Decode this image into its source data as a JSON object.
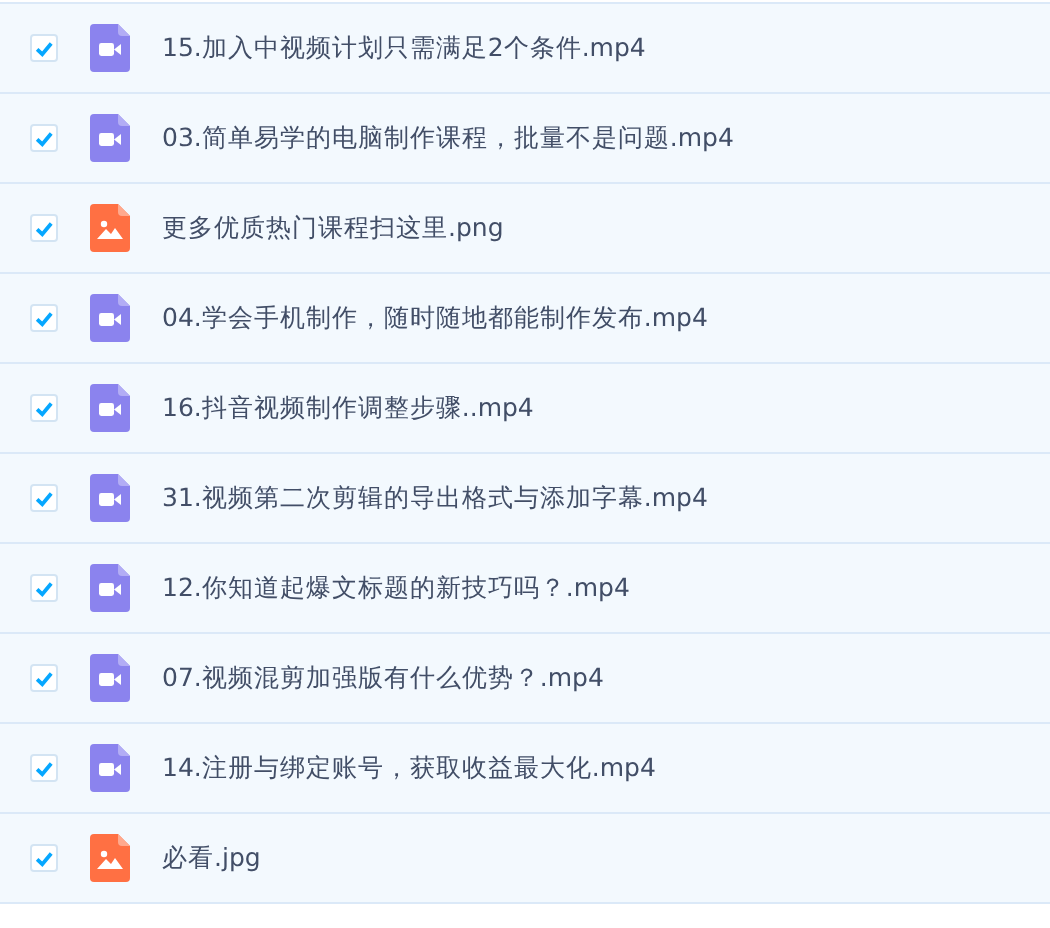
{
  "files": [
    {
      "name": "15.加入中视频计划只需满足2个条件.mp4",
      "kind": "video",
      "checked": true
    },
    {
      "name": "03.简单易学的电脑制作课程，批量不是问题.mp4",
      "kind": "video",
      "checked": true
    },
    {
      "name": "更多优质热门课程扫这里.png",
      "kind": "image",
      "checked": true
    },
    {
      "name": "04.学会手机制作，随时随地都能制作发布.mp4",
      "kind": "video",
      "checked": true
    },
    {
      "name": "16.抖音视频制作调整步骤..mp4",
      "kind": "video",
      "checked": true
    },
    {
      "name": "31.视频第二次剪辑的导出格式与添加字幕.mp4",
      "kind": "video",
      "checked": true
    },
    {
      "name": "12.你知道起爆文标题的新技巧吗？.mp4",
      "kind": "video",
      "checked": true
    },
    {
      "name": "07.视频混剪加强版有什么优势？.mp4",
      "kind": "video",
      "checked": true
    },
    {
      "name": "14.注册与绑定账号，获取收益最大化.mp4",
      "kind": "video",
      "checked": true
    },
    {
      "name": "必看.jpg",
      "kind": "image",
      "checked": true
    }
  ]
}
